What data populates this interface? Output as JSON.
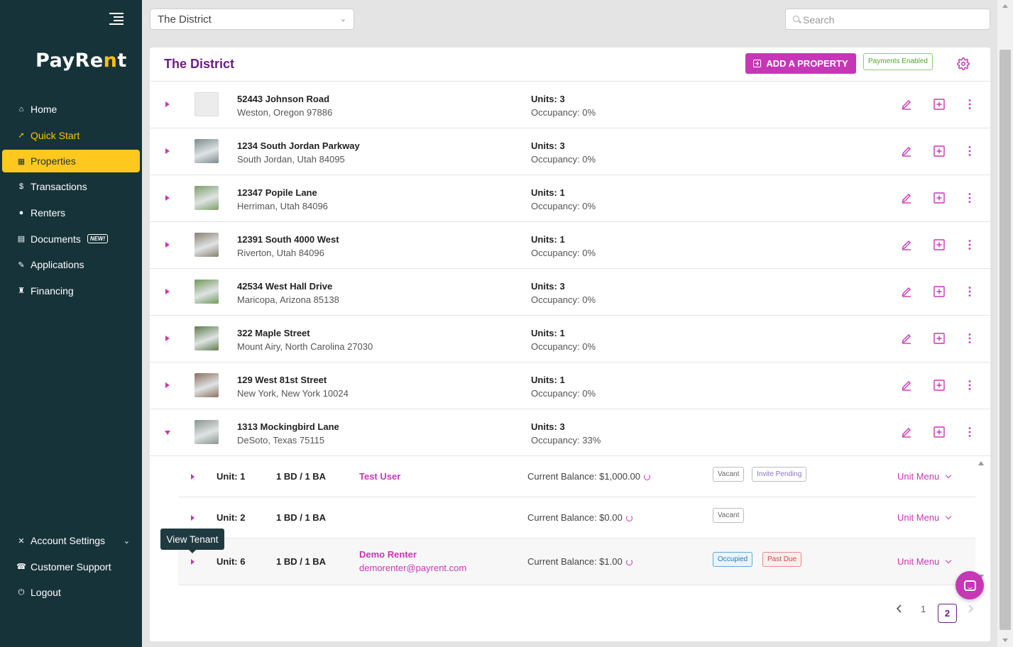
{
  "app": {
    "logo_text_a": "PayRe",
    "logo_text_b": "n",
    "logo_text_c": "t",
    "colors": {
      "sidebar": "#17333a",
      "accent": "#c637b6",
      "active": "#ffc81e",
      "title": "#6b1d84"
    }
  },
  "sidebar": {
    "items": [
      {
        "label": "Home",
        "icon": "home-icon"
      },
      {
        "label": "Quick Start",
        "icon": "rocket-icon"
      },
      {
        "label": "Properties",
        "icon": "building-icon"
      },
      {
        "label": "Transactions",
        "icon": "money-icon"
      },
      {
        "label": "Renters",
        "icon": "users-icon"
      },
      {
        "label": "Documents",
        "icon": "document-icon",
        "badge": "NEW!"
      },
      {
        "label": "Applications",
        "icon": "clipboard-icon"
      },
      {
        "label": "Financing",
        "icon": "bank-icon"
      }
    ],
    "bottom": [
      {
        "label": "Account Settings",
        "icon": "tools-icon"
      },
      {
        "label": "Customer Support",
        "icon": "support-icon"
      },
      {
        "label": "Logout",
        "icon": "logout-icon"
      }
    ]
  },
  "topbar": {
    "property_select": "The District",
    "search_placeholder": "Search"
  },
  "card": {
    "title": "The District",
    "add_button": "ADD A PROPERTY",
    "payments_badge": "Payments Enabled"
  },
  "properties": [
    {
      "street": "52443 Johnson Road",
      "city": "Weston, Oregon 97886",
      "units": "Units: 3",
      "occupancy": "Occupancy: 0%"
    },
    {
      "street": "1234 South Jordan Parkway",
      "city": "South Jordan, Utah 84095",
      "units": "Units: 3",
      "occupancy": "Occupancy: 0%"
    },
    {
      "street": "12347 Popile Lane",
      "city": "Herriman, Utah 84096",
      "units": "Units: 1",
      "occupancy": "Occupancy: 0%"
    },
    {
      "street": "12391 South 4000 West",
      "city": "Riverton, Utah 84096",
      "units": "Units: 1",
      "occupancy": "Occupancy: 0%"
    },
    {
      "street": "42534 West Hall Drive",
      "city": "Maricopa, Arizona 85138",
      "units": "Units: 3",
      "occupancy": "Occupancy: 0%"
    },
    {
      "street": "322 Maple Street",
      "city": "Mount Airy, North Carolina 27030",
      "units": "Units: 1",
      "occupancy": "Occupancy: 0%"
    },
    {
      "street": "129 West 81st Street",
      "city": "New York, New York 10024",
      "units": "Units: 1",
      "occupancy": "Occupancy: 0%"
    },
    {
      "street": "1313 Mockingbird Lane",
      "city": "DeSoto, Texas 75115",
      "units": "Units: 3",
      "occupancy": "Occupancy: 33%"
    }
  ],
  "units": [
    {
      "name": "Unit: 1",
      "bdba": "1 BD / 1 BA",
      "tenant": "Test User",
      "balance": "Current Balance: $1,000.00",
      "tags": [
        "Vacant",
        "Invite Pending"
      ],
      "menu": "Unit Menu"
    },
    {
      "name": "Unit: 2",
      "bdba": "1 BD / 1 BA",
      "tenant": "",
      "balance": "Current Balance: $0.00",
      "tags": [
        "Vacant"
      ],
      "menu": "Unit Menu"
    },
    {
      "name": "Unit: 6",
      "bdba": "1 BD / 1 BA",
      "tenant": "Demo Renter",
      "email": "demorenter@payrent.com",
      "balance": "Current Balance: $1.00",
      "tags": [
        "Occupied",
        "Past Due"
      ],
      "menu": "Unit Menu"
    }
  ],
  "tooltip": "View Tenant",
  "pagination": {
    "pages": [
      "1",
      "2"
    ],
    "current": "2"
  }
}
